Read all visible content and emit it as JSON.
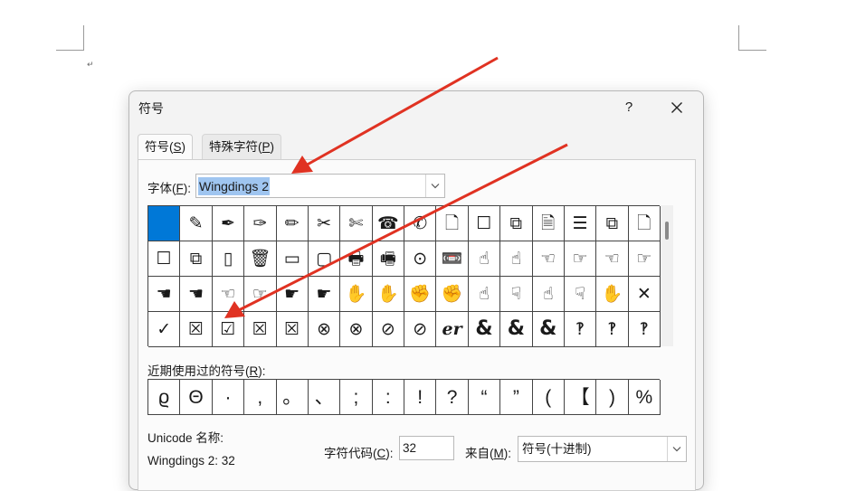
{
  "dialog": {
    "title": "符号",
    "help_label": "?"
  },
  "tabs": [
    {
      "prefix": "符号(",
      "key": "S",
      "suffix": ")"
    },
    {
      "prefix": "特殊字符(",
      "key": "P",
      "suffix": ")"
    }
  ],
  "font": {
    "label_prefix": "字体(",
    "label_key": "F",
    "label_suffix": "):",
    "value": "Wingdings 2"
  },
  "symbols": [
    "",
    "✎",
    "✒",
    "✑",
    "✏",
    "✂",
    "✄",
    "☎",
    "✆",
    "🗋",
    "☐",
    "⧉",
    "🗎",
    "☰",
    "⧉",
    "🗋",
    "☐",
    "⧉",
    "▯",
    "🗑",
    "▭",
    "▢",
    "🖶",
    "🖷",
    "⊙",
    "📼",
    "☝",
    "☝",
    "☜",
    "☞",
    "☜",
    "☞",
    "☚",
    "☚",
    "☜",
    "☞",
    "☛",
    "☛",
    "✋",
    "✋",
    "✊",
    "✊",
    "☝",
    "☟",
    "☝",
    "☟",
    "✋",
    "✕",
    "✓",
    "☒",
    "☑",
    "☒",
    "☒",
    "⊗",
    "⊗",
    "⊘",
    "⊘",
    "er",
    "&",
    "&",
    "&",
    "‽",
    "‽",
    "‽"
  ],
  "selected_index": 0,
  "recent": {
    "label_prefix": "近期使用过的符号(",
    "label_key": "R",
    "label_suffix": "):",
    "items": [
      "ϱ",
      "Θ",
      "·",
      ",",
      "。",
      "、",
      ";",
      ":",
      "!",
      "?",
      "“",
      "”",
      "(",
      "【",
      ")",
      "%"
    ]
  },
  "unicode": {
    "label": "Unicode 名称:",
    "value": "Wingdings 2: 32"
  },
  "char_code": {
    "label_prefix": "字符代码(",
    "label_key": "C",
    "label_suffix": "):",
    "value": "32"
  },
  "from": {
    "label_prefix": "来自(",
    "label_key": "M",
    "label_suffix": "):",
    "value": "符号(十进制)"
  },
  "document": {
    "para_mark": "↵"
  },
  "colors": {
    "selection": "#0078d7",
    "font_highlight": "#9fc5f0",
    "annotation_arrow": "#e03222"
  }
}
